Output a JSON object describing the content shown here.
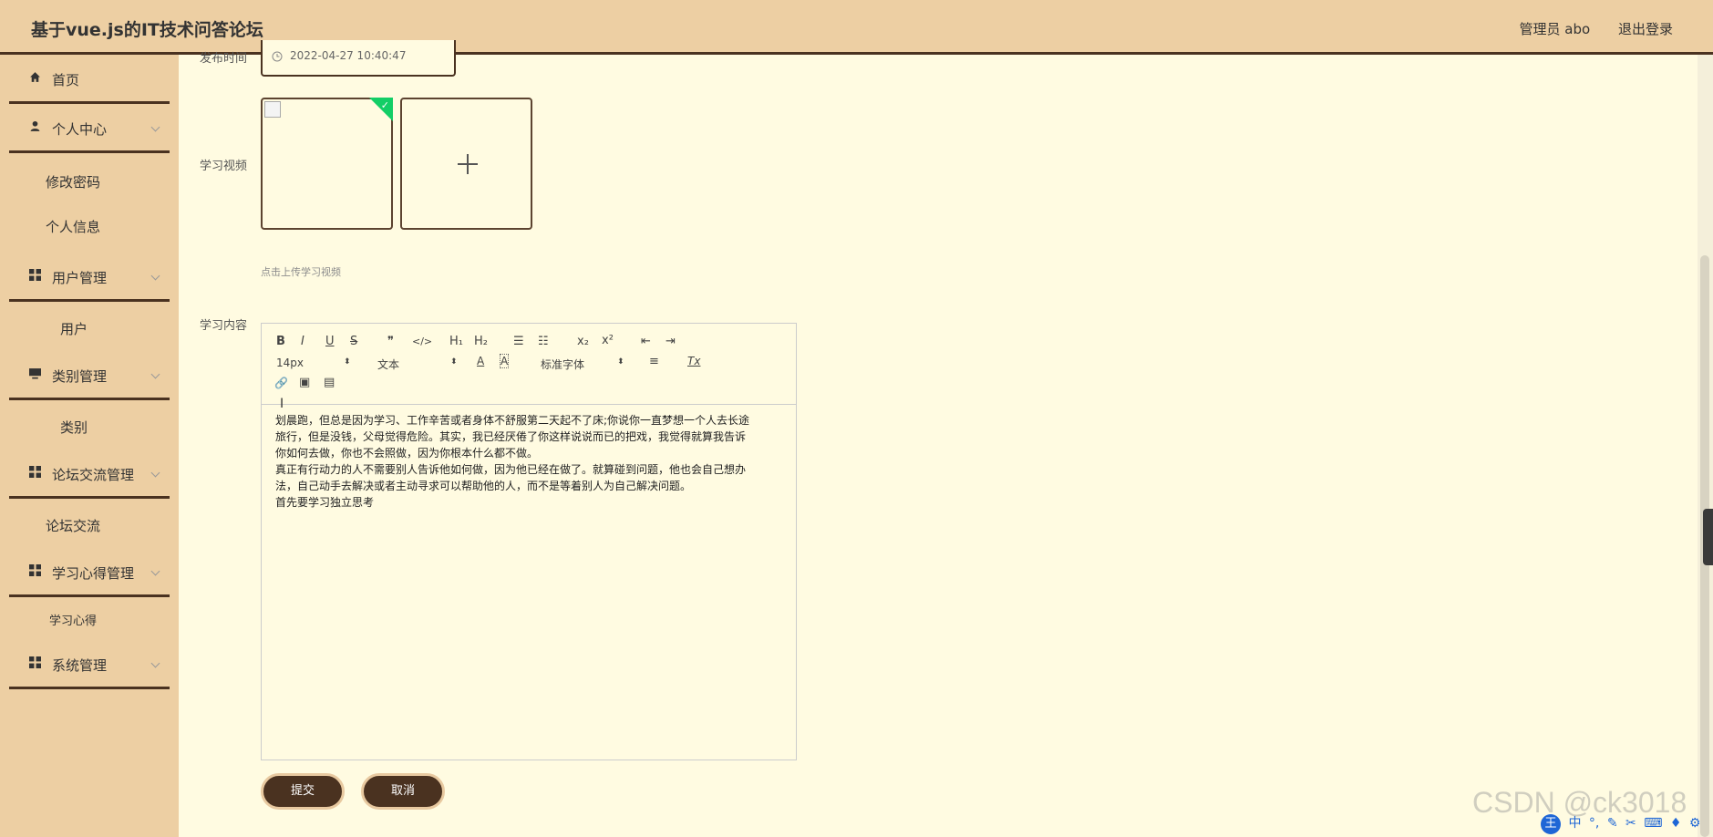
{
  "header": {
    "title": "基于vue.js的IT技术问答论坛",
    "user_label": "管理员 abo",
    "logout_label": "退出登录"
  },
  "sidebar": {
    "items": [
      {
        "label": "首页",
        "icon": "home-icon"
      },
      {
        "label": "个人中心",
        "icon": "user-icon"
      },
      {
        "label": "修改密码"
      },
      {
        "label": "个人信息"
      },
      {
        "label": "用户管理",
        "icon": "grid-icon"
      },
      {
        "label": "用户"
      },
      {
        "label": "类别管理",
        "icon": "monitor-icon"
      },
      {
        "label": "类别"
      },
      {
        "label": "论坛交流管理",
        "icon": "grid-icon"
      },
      {
        "label": "论坛交流"
      },
      {
        "label": "学习心得管理",
        "icon": "grid-icon"
      },
      {
        "label": "学习心得"
      },
      {
        "label": "系统管理",
        "icon": "grid-icon"
      }
    ]
  },
  "form": {
    "publish_time_label": "发布时间",
    "publish_time_value": "2022-04-27 10:40:47",
    "video_label": "学习视频",
    "upload_hint": "点击上传学习视频",
    "content_label": "学习内容"
  },
  "editor": {
    "toolbar": {
      "bold": "B",
      "italic": "I",
      "underline": "U",
      "strike": "S",
      "quote": "❞",
      "code": "</>",
      "h1": "H₁",
      "h2": "H₂",
      "ordered_list": "☰",
      "bullet_list": "☷",
      "subscript": "x₂",
      "superscript": "x²",
      "outdent": "⇤",
      "indent": "⇥",
      "size": "14px",
      "block": "文本",
      "font": "标准字体",
      "color": "A",
      "background": "A",
      "align": "≡",
      "clean": "Tx",
      "link": "🔗",
      "image": "▣",
      "video": "▤"
    },
    "content_lines": [
      "划晨跑，但总是因为学习、工作辛苦或者身体不舒服第二天起不了床;你说你一直梦想一个人去长途",
      "旅行，但是没钱，父母觉得危险。其实，我已经厌倦了你这样说说而已的把戏，我觉得就算我告诉",
      "你如何去做，你也不会照做，因为你根本什么都不做。",
      "真正有行动力的人不需要别人告诉他如何做，因为他已经在做了。就算碰到问题，他也会自己想办",
      "法，自己动手去解决或者主动寻求可以帮助他的人，而不是等着别人为自己解决问题。",
      "首先要学习独立思考"
    ]
  },
  "buttons": {
    "submit": "提交",
    "cancel": "取消"
  },
  "watermark": "CSDN @ck3018",
  "ime": {
    "logo": "王",
    "mode": "中"
  },
  "colors": {
    "header_bg": "#EDCFA3",
    "sidebar_bg": "#EDCFA3",
    "page_bg": "#FFFBE1",
    "accent_dark": "#4A3220",
    "success": "#13CE66"
  }
}
